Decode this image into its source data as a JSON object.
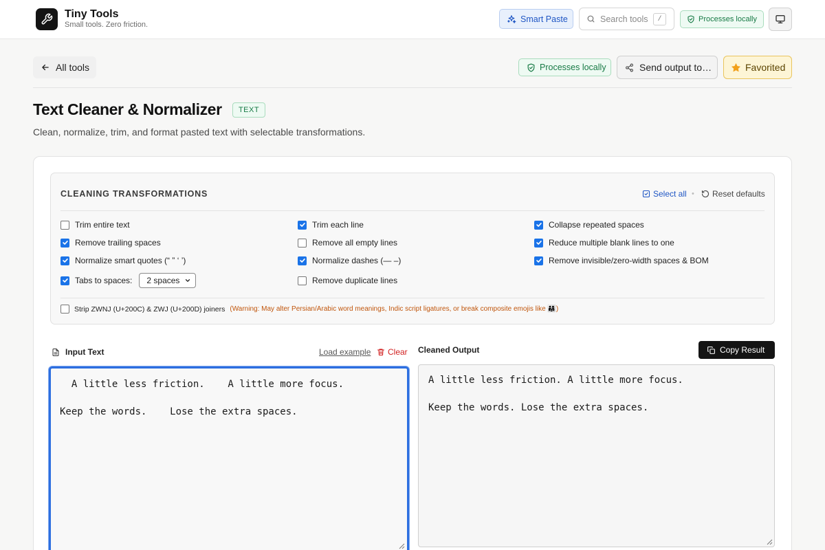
{
  "header": {
    "brand_title": "Tiny Tools",
    "brand_sub": "Small tools. Zero friction.",
    "smart_paste_label": "Smart Paste",
    "search_placeholder": "Search tools",
    "search_shortcut": "/",
    "processes_locally": "Processes locally"
  },
  "toolbar": {
    "back_label": "All tools",
    "processes_locally": "Processes locally",
    "send_label": "Send output to…",
    "favorite_label": "Favorited"
  },
  "page": {
    "title": "Text Cleaner & Normalizer",
    "type_badge": "TEXT",
    "description": "Clean, normalize, trim, and format pasted text with selectable transformations."
  },
  "panel": {
    "title": "CLEANING TRANSFORMATIONS",
    "select_all": "Select all",
    "reset": "Reset defaults",
    "options": [
      {
        "label": "Trim entire text",
        "checked": false
      },
      {
        "label": "Trim each line",
        "checked": true
      },
      {
        "label": "Collapse repeated spaces",
        "checked": true
      },
      {
        "label": "Remove trailing spaces",
        "checked": true
      },
      {
        "label": "Remove all empty lines",
        "checked": false
      },
      {
        "label": "Reduce multiple blank lines to one",
        "checked": true
      },
      {
        "label": "Normalize smart quotes (“ ” ‘ ’)",
        "checked": true
      },
      {
        "label": "Normalize dashes (— –)",
        "checked": true
      },
      {
        "label": "Remove invisible/zero-width spaces & BOM",
        "checked": true
      },
      {
        "label": "Tabs to spaces:",
        "checked": true
      },
      {
        "label": "Remove duplicate lines",
        "checked": false
      }
    ],
    "tabs_value": "2 spaces",
    "strip_label": "Strip ZWNJ (U+200C) & ZWJ (U+200D) joiners",
    "strip_checked": false,
    "strip_warning": "(Warning: May alter Persian/Arabic word meanings, Indic script ligatures, or break composite emojis like 👨‍👩‍👧)"
  },
  "input": {
    "label": "Input Text",
    "load_example": "Load example",
    "clear": "Clear",
    "text": "  A little less friction.    A little more focus.\n\nKeep the words.    Lose the extra spaces."
  },
  "output": {
    "label": "Cleaned Output",
    "copy": "Copy Result",
    "text": "A little less friction. A little more focus.\n\nKeep the words. Lose the extra spaces."
  },
  "colors": {
    "accent": "#1a73e8",
    "success": "#177a45",
    "danger": "#d11f1f",
    "warning": "#c0550b",
    "favorite": "#f2a01a"
  }
}
